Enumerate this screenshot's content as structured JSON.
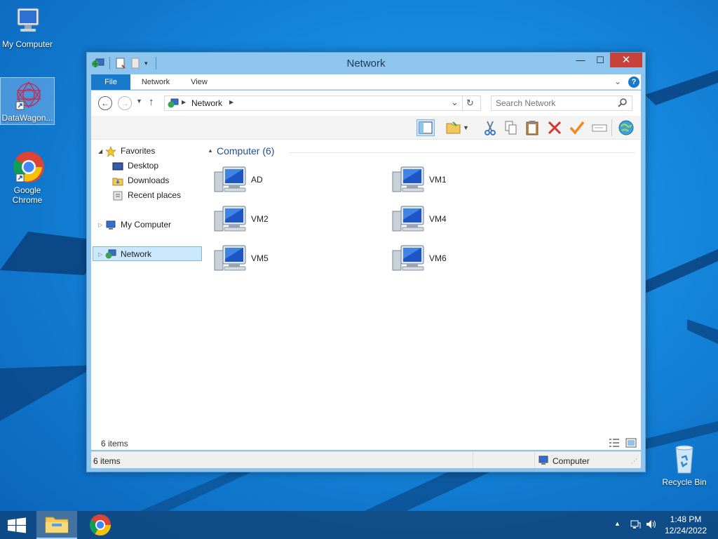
{
  "desktop": {
    "icons": [
      {
        "label": "My Computer"
      },
      {
        "label": "DataWagon..."
      },
      {
        "label": "Google Chrome"
      },
      {
        "label": "Recycle Bin"
      }
    ]
  },
  "window": {
    "title": "Network",
    "tabs": [
      {
        "label": "File"
      },
      {
        "label": "Network"
      },
      {
        "label": "View"
      }
    ],
    "address": {
      "path": "Network"
    },
    "search": {
      "placeholder": "Search Network"
    },
    "nav_pane": {
      "favorites": "Favorites",
      "desktop": "Desktop",
      "downloads": "Downloads",
      "recent": "Recent places",
      "my_computer": "My Computer",
      "network": "Network"
    },
    "group": {
      "label": "Computer (6)"
    },
    "computers": [
      "AD",
      "VM1",
      "VM2",
      "VM4",
      "VM5",
      "VM6"
    ],
    "details_count": "6 items",
    "status": {
      "count": "6 items",
      "location": "Computer"
    }
  },
  "taskbar": {
    "time": "1:48 PM",
    "date": "12/24/2022"
  },
  "colors": {
    "accent": "#1979ca",
    "close": "#c7423b",
    "selection": "#cce8ff"
  }
}
